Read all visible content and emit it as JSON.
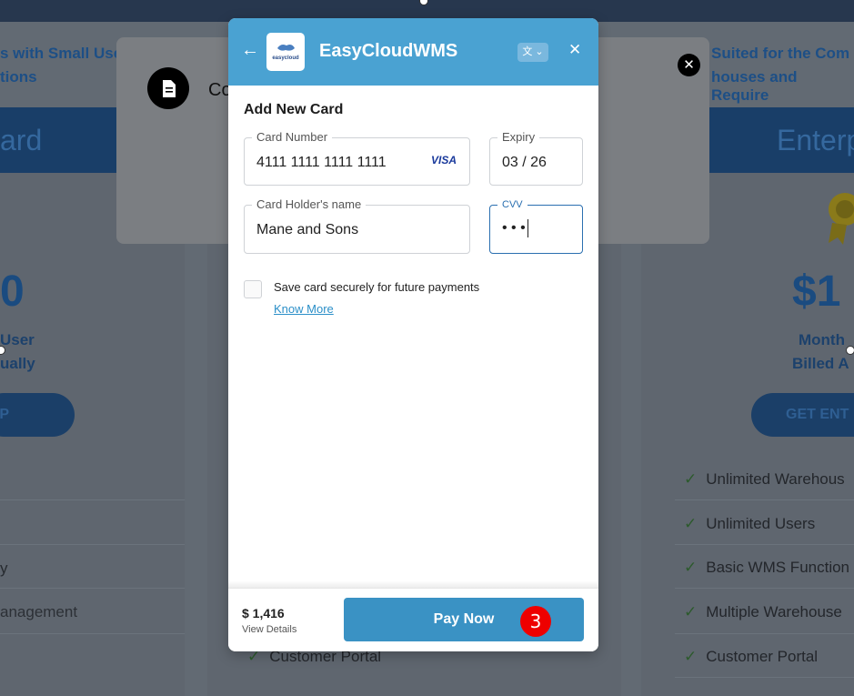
{
  "background": {
    "left_heading_lines": [
      "s with Small Use",
      "tions"
    ],
    "right_heading_lines": [
      "Suited for the Com",
      "houses and Require"
    ],
    "left_plan_title": "ard",
    "right_plan_title": "Enterp",
    "left_price": "0",
    "right_price": "$1",
    "left_billing_lines": [
      "User",
      "ually"
    ],
    "right_billing_lines": [
      "Month",
      "Billed A"
    ],
    "left_button": "P",
    "right_button": "GET ENT",
    "left_features": [
      "y",
      "anagement"
    ],
    "right_features": [
      "Unlimited Warehous",
      "Unlimited Users",
      "Basic WMS Function",
      "Multiple Warehouse",
      "Customer Portal"
    ],
    "middle_feature": "Customer Portal",
    "underlying_dialog_text": "Co"
  },
  "modal": {
    "brand": "EasyCloudWMS",
    "logo_text": "easycloud",
    "lang_label": "文 ⌄",
    "section_title": "Add New Card",
    "card_number": {
      "label": "Card Number",
      "value": "4111 1111 1111 1111",
      "brand": "VISA"
    },
    "expiry": {
      "label": "Expiry",
      "value": "03 / 26"
    },
    "holder": {
      "label": "Card Holder's name",
      "value": "Mane and Sons"
    },
    "cvv": {
      "label": "CVV",
      "value": "• • •"
    },
    "save_card_label": "Save card securely for future payments",
    "know_more": "Know More",
    "amount": "$ 1,416",
    "view_details": "View Details",
    "pay_now": "Pay Now"
  },
  "step_badge": "3",
  "colors": {
    "header": "#4aa2d2",
    "pay_button": "#3a92c4",
    "link": "#2b8fc8",
    "badge": "#ee0000"
  }
}
